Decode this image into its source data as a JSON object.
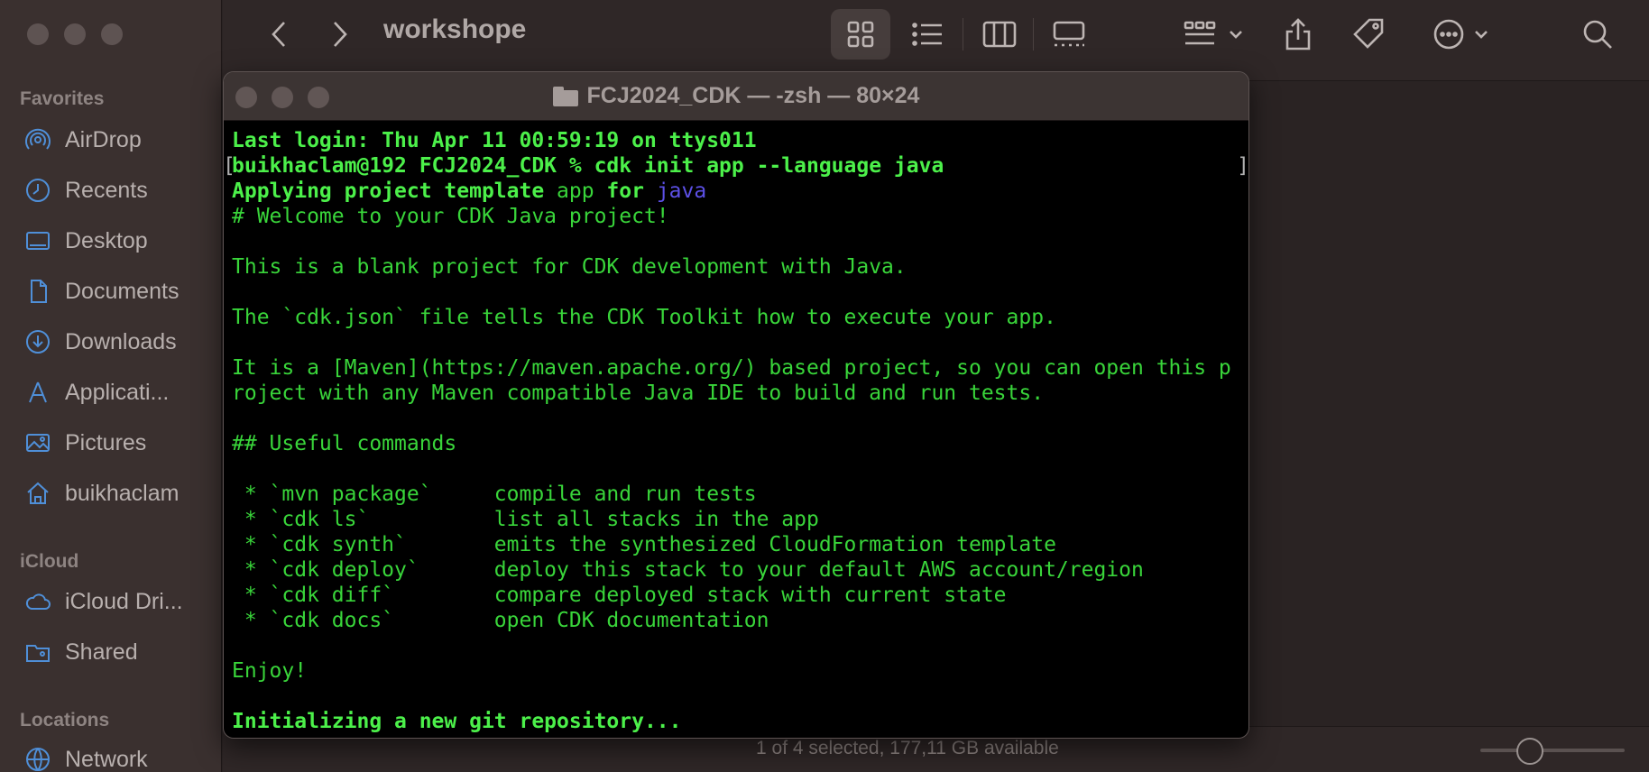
{
  "finder": {
    "title": "workshope",
    "sidebar": {
      "favorites_label": "Favorites",
      "favorites": [
        {
          "label": "AirDrop",
          "icon": "airdrop-icon"
        },
        {
          "label": "Recents",
          "icon": "clock-icon"
        },
        {
          "label": "Desktop",
          "icon": "desktop-icon"
        },
        {
          "label": "Documents",
          "icon": "document-icon"
        },
        {
          "label": "Downloads",
          "icon": "download-icon"
        },
        {
          "label": "Applicati...",
          "icon": "applications-icon"
        },
        {
          "label": "Pictures",
          "icon": "pictures-icon"
        },
        {
          "label": "buikhaclam",
          "icon": "home-icon"
        }
      ],
      "icloud_label": "iCloud",
      "icloud": [
        {
          "label": "iCloud Dri...",
          "icon": "cloud-icon"
        },
        {
          "label": "Shared",
          "icon": "shared-folder-icon"
        }
      ],
      "locations_label": "Locations",
      "locations": [
        {
          "label": "Network",
          "icon": "network-icon"
        }
      ]
    },
    "status": "1 of 4 selected, 177,11 GB available",
    "accent_color": "#4f8fd8"
  },
  "terminal": {
    "title": "FCJ2024_CDK — -zsh — 80×24",
    "lines": [
      {
        "text": "Last login: Thu Apr 11 00:59:19 on ttys011",
        "style": "bright"
      },
      {
        "text": "buikhaclam@192 FCJ2024_CDK % cdk init app --language java",
        "style": "bright"
      },
      {
        "text": "Applying project template ",
        "style": "bright",
        "mid": "app",
        "mid2": " for ",
        "end": "java"
      },
      {
        "text": "# Welcome to your CDK Java project!",
        "style": "normal"
      },
      {
        "text": "",
        "style": "normal"
      },
      {
        "text": "This is a blank project for CDK development with Java.",
        "style": "normal"
      },
      {
        "text": "",
        "style": "normal"
      },
      {
        "text": "The `cdk.json` file tells the CDK Toolkit how to execute your app.",
        "style": "normal"
      },
      {
        "text": "",
        "style": "normal"
      },
      {
        "text": "It is a [Maven](https://maven.apache.org/) based project, so you can open this p",
        "style": "normal"
      },
      {
        "text": "roject with any Maven compatible Java IDE to build and run tests.",
        "style": "normal"
      },
      {
        "text": "",
        "style": "normal"
      },
      {
        "text": "## Useful commands",
        "style": "normal"
      },
      {
        "text": "",
        "style": "normal"
      },
      {
        "text": " * `mvn package`     compile and run tests",
        "style": "normal"
      },
      {
        "text": " * `cdk ls`          list all stacks in the app",
        "style": "normal"
      },
      {
        "text": " * `cdk synth`       emits the synthesized CloudFormation template",
        "style": "normal"
      },
      {
        "text": " * `cdk deploy`      deploy this stack to your default AWS account/region",
        "style": "normal"
      },
      {
        "text": " * `cdk diff`        compare deployed stack with current state",
        "style": "normal"
      },
      {
        "text": " * `cdk docs`        open CDK documentation",
        "style": "normal"
      },
      {
        "text": "",
        "style": "normal"
      },
      {
        "text": "Enjoy!",
        "style": "normal"
      },
      {
        "text": "",
        "style": "normal"
      },
      {
        "text": "Initializing a new git repository...",
        "style": "bright"
      }
    ],
    "text_color": "#39d53a",
    "highlight_color": "#5c50e6"
  }
}
